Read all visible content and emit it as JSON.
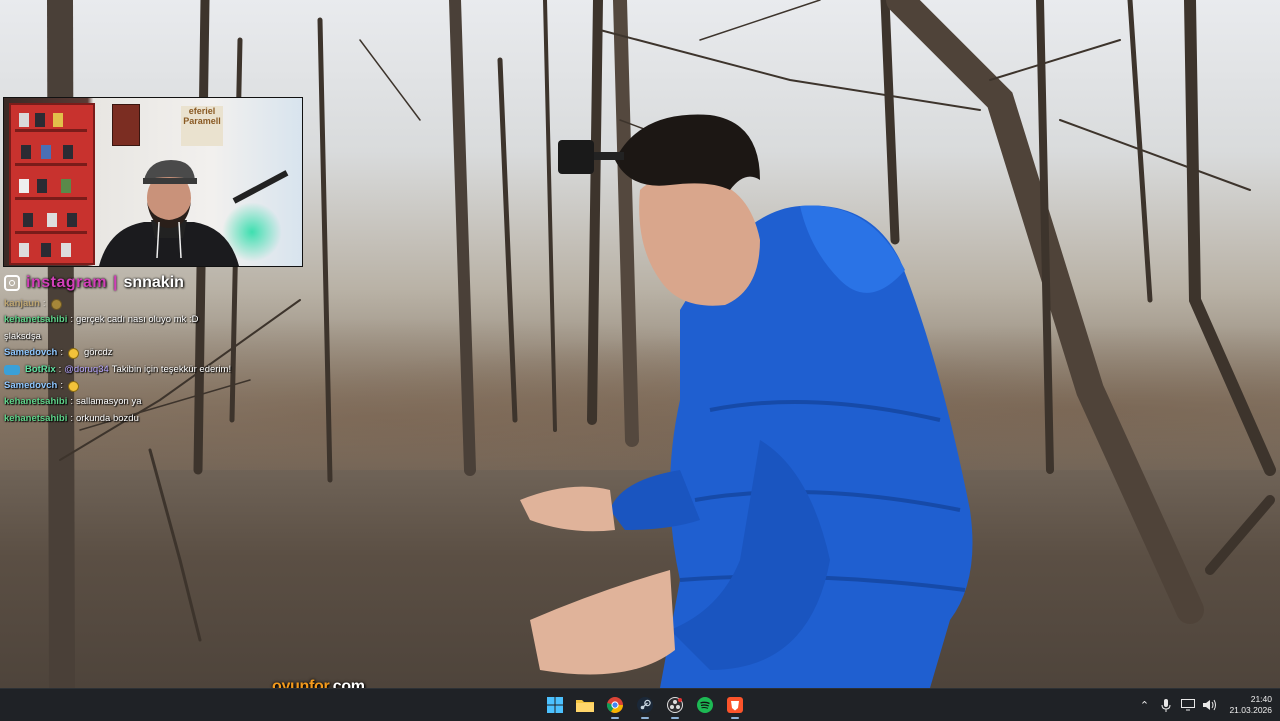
{
  "overlay": {
    "instagram_label": "instagram",
    "instagram_separator": "|",
    "instagram_handle": "snnakin",
    "webcam_sign_line1": "eferiel",
    "webcam_sign_line2": "Paramell"
  },
  "chat": {
    "messages": [
      {
        "user": "kanjaun",
        "text": "",
        "faded": true
      },
      {
        "user": "kehanetsahibi",
        "text": "gerçek cadı nası oluyo mk :D"
      },
      {
        "user": "",
        "text": "şlaksdşa"
      },
      {
        "user": "Samedovch",
        "text": "görcdz",
        "emote": true
      },
      {
        "user": "BotRix",
        "mention": "@doruq34",
        "text": "Takibin için teşekkür ederim!",
        "bot": true
      },
      {
        "user": "Samedovch",
        "text": "",
        "emote": true
      },
      {
        "user": "kehanetsahibi",
        "text": "sallamasyon ya"
      },
      {
        "user": "kehanetsahibi",
        "text": "orkunda bozdu"
      }
    ],
    "user_colors": {
      "kehanetsahibi": "#5fd38a",
      "Samedovch": "#8fc7ff",
      "BotRix": "#5fe0a0",
      "kanjaun": "#c7a24f"
    }
  },
  "watermark": {
    "brand": "oyunfor",
    "tld": ".com"
  },
  "taskbar": {
    "apps": [
      {
        "name": "windows-start",
        "icon": "windows-icon"
      },
      {
        "name": "file-explorer",
        "icon": "folder-icon"
      },
      {
        "name": "chrome",
        "icon": "chrome-icon"
      },
      {
        "name": "steam",
        "icon": "steam-icon"
      },
      {
        "name": "obs",
        "icon": "obs-icon"
      },
      {
        "name": "spotify",
        "icon": "spotify-icon"
      },
      {
        "name": "brave",
        "icon": "brave-icon"
      }
    ],
    "time": "21:40",
    "date": "21.03.2026"
  },
  "colors": {
    "taskbar_bg": "#1f2226",
    "watermark_orange": "#f39a1d",
    "instagram_pink": "#d13fb8",
    "jacket_blue": "#1f5fd0"
  }
}
